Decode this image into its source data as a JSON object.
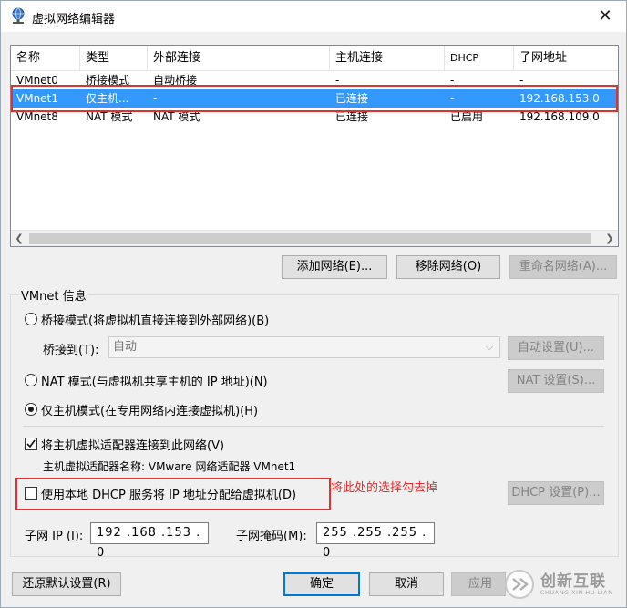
{
  "window": {
    "title": "虚拟网络编辑器",
    "close_glyph": "✕"
  },
  "list": {
    "columns": [
      "名称",
      "类型",
      "外部连接",
      "主机连接",
      "DHCP",
      "子网地址"
    ],
    "rows": [
      {
        "name": "VMnet0",
        "type": "桥接模式",
        "external": "自动桥接",
        "host": "-",
        "dhcp": "-",
        "subnet": "-"
      },
      {
        "name": "VMnet1",
        "type": "仅主机...",
        "external": "-",
        "host": "已连接",
        "dhcp": "-",
        "subnet": "192.168.153.0"
      },
      {
        "name": "VMnet8",
        "type": "NAT 模式",
        "external": "NAT 模式",
        "host": "已连接",
        "dhcp": "已启用",
        "subnet": "192.168.109.0"
      }
    ],
    "selected_row": 1
  },
  "list_buttons": {
    "add": "添加网络(E)...",
    "remove": "移除网络(O)",
    "rename": "重命名网络(A)..."
  },
  "vmnet_info": {
    "title": "VMnet 信息",
    "bridged_label": "桥接模式(将虚拟机直接连接到外部网络)(B)",
    "bridged_to_label": "桥接到(T):",
    "bridged_to_value": "自动",
    "auto_settings": "自动设置(U)...",
    "nat_label": "NAT 模式(与虚拟机共享主机的 IP 地址)(N)",
    "nat_settings": "NAT 设置(S)...",
    "hostonly_label": "仅主机模式(在专用网络内连接虚拟机)(H)",
    "connect_adapter_label": "将主机虚拟适配器连接到此网络(V)",
    "adapter_name_label": "主机虚拟适配器名称: VMware 网络适配器 VMnet1",
    "dhcp_label": "使用本地 DHCP 服务将 IP 地址分配给虚拟机(D)",
    "dhcp_settings": "DHCP 设置(P)...",
    "subnet_ip_label": "子网 IP (I):",
    "subnet_ip_value": "192 .168 .153 .  0",
    "subnet_mask_label": "子网掩码(M):",
    "subnet_mask_value": "255 .255 .255 .  0"
  },
  "annotation": "将此处的选择勾去掉",
  "footer": {
    "restore": "还原默认设置(R)",
    "ok": "确定",
    "cancel": "取消",
    "apply": "应用"
  },
  "watermark": {
    "cn": "创新互联",
    "en": "CHUANG XIN HU LIAN"
  },
  "colors": {
    "selection": "#3399ff",
    "highlight": "#e03030",
    "default_button": "#0078d7"
  }
}
